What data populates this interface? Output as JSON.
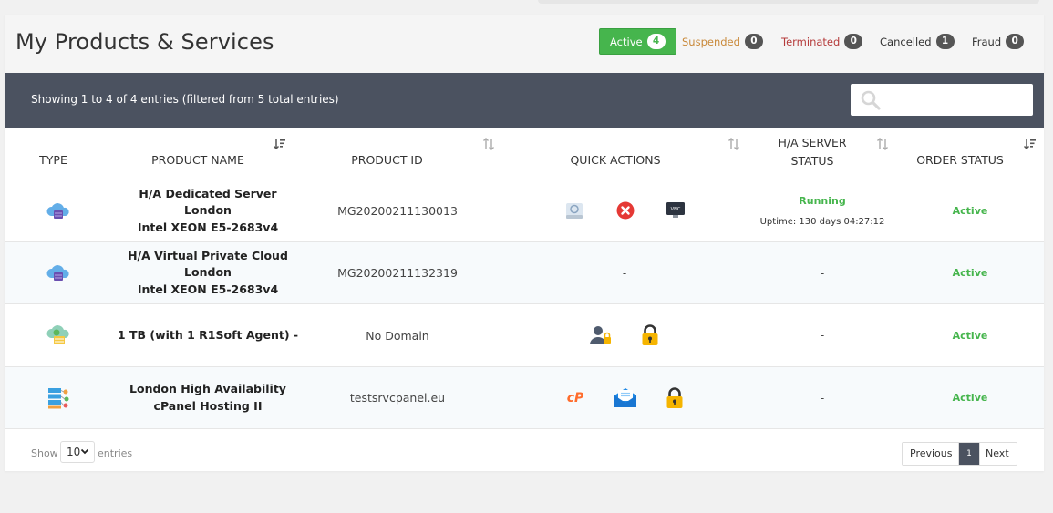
{
  "page": {
    "title": "My Products & Services"
  },
  "filters": [
    {
      "label": "Active",
      "count": "4"
    },
    {
      "label": "Suspended",
      "count": "0"
    },
    {
      "label": "Terminated",
      "count": "0"
    },
    {
      "label": "Cancelled",
      "count": "1"
    },
    {
      "label": "Fraud",
      "count": "0"
    }
  ],
  "toolbar": {
    "showing": "Showing 1 to 4 of 4 entries (filtered from 5 total entries)",
    "search_placeholder": ""
  },
  "table": {
    "headers": [
      "TYPE",
      "PRODUCT NAME",
      "PRODUCT ID",
      "QUICK ACTIONS",
      "H/A SERVER STATUS",
      "ORDER STATUS"
    ],
    "headers_split": {
      "ha_line1": "H/A SERVER",
      "ha_line2": "STATUS"
    },
    "rows": [
      {
        "type_icon": "cloud-server-icon",
        "name_lines": [
          "H/A Dedicated Server",
          "London",
          "Intel XEON E5-2683v4"
        ],
        "product_id": "MG20200211130013",
        "actions": [
          "reboot-server-icon",
          "stop-server-icon",
          "vnc-console-icon"
        ],
        "server_status": "Running",
        "uptime": "Uptime: 130 days 04:27:12",
        "order_status": "Active"
      },
      {
        "type_icon": "cloud-server-icon",
        "name_lines": [
          "H/A Virtual Private Cloud",
          "London",
          "Intel XEON E5-2683v4"
        ],
        "product_id": "MG20200211132319",
        "actions_text": "-",
        "server_status": "-",
        "order_status": "Active"
      },
      {
        "type_icon": "cloud-backup-icon",
        "name_lines": [
          "1 TB (with 1 R1Soft Agent) -"
        ],
        "product_id": "No Domain",
        "actions": [
          "user-lock-icon",
          "padlock-icon"
        ],
        "server_status": "-",
        "order_status": "Active"
      },
      {
        "type_icon": "hosting-icon",
        "name_lines": [
          "London High Availability",
          "cPanel Hosting II"
        ],
        "product_id": "testsrvcpanel.eu",
        "actions": [
          "cpanel-icon",
          "webmail-icon",
          "padlock-icon"
        ],
        "server_status": "-",
        "order_status": "Active"
      }
    ]
  },
  "footer": {
    "show_label": "Show",
    "page_size": "10",
    "entries_label": "entries",
    "pager": {
      "previous": "Previous",
      "current": "1",
      "next": "Next"
    }
  },
  "colors": {
    "accent_green": "#46b54d",
    "toolbar_bg": "#4b5260",
    "suspended": "#c9893a",
    "terminated": "#b53b3b"
  }
}
